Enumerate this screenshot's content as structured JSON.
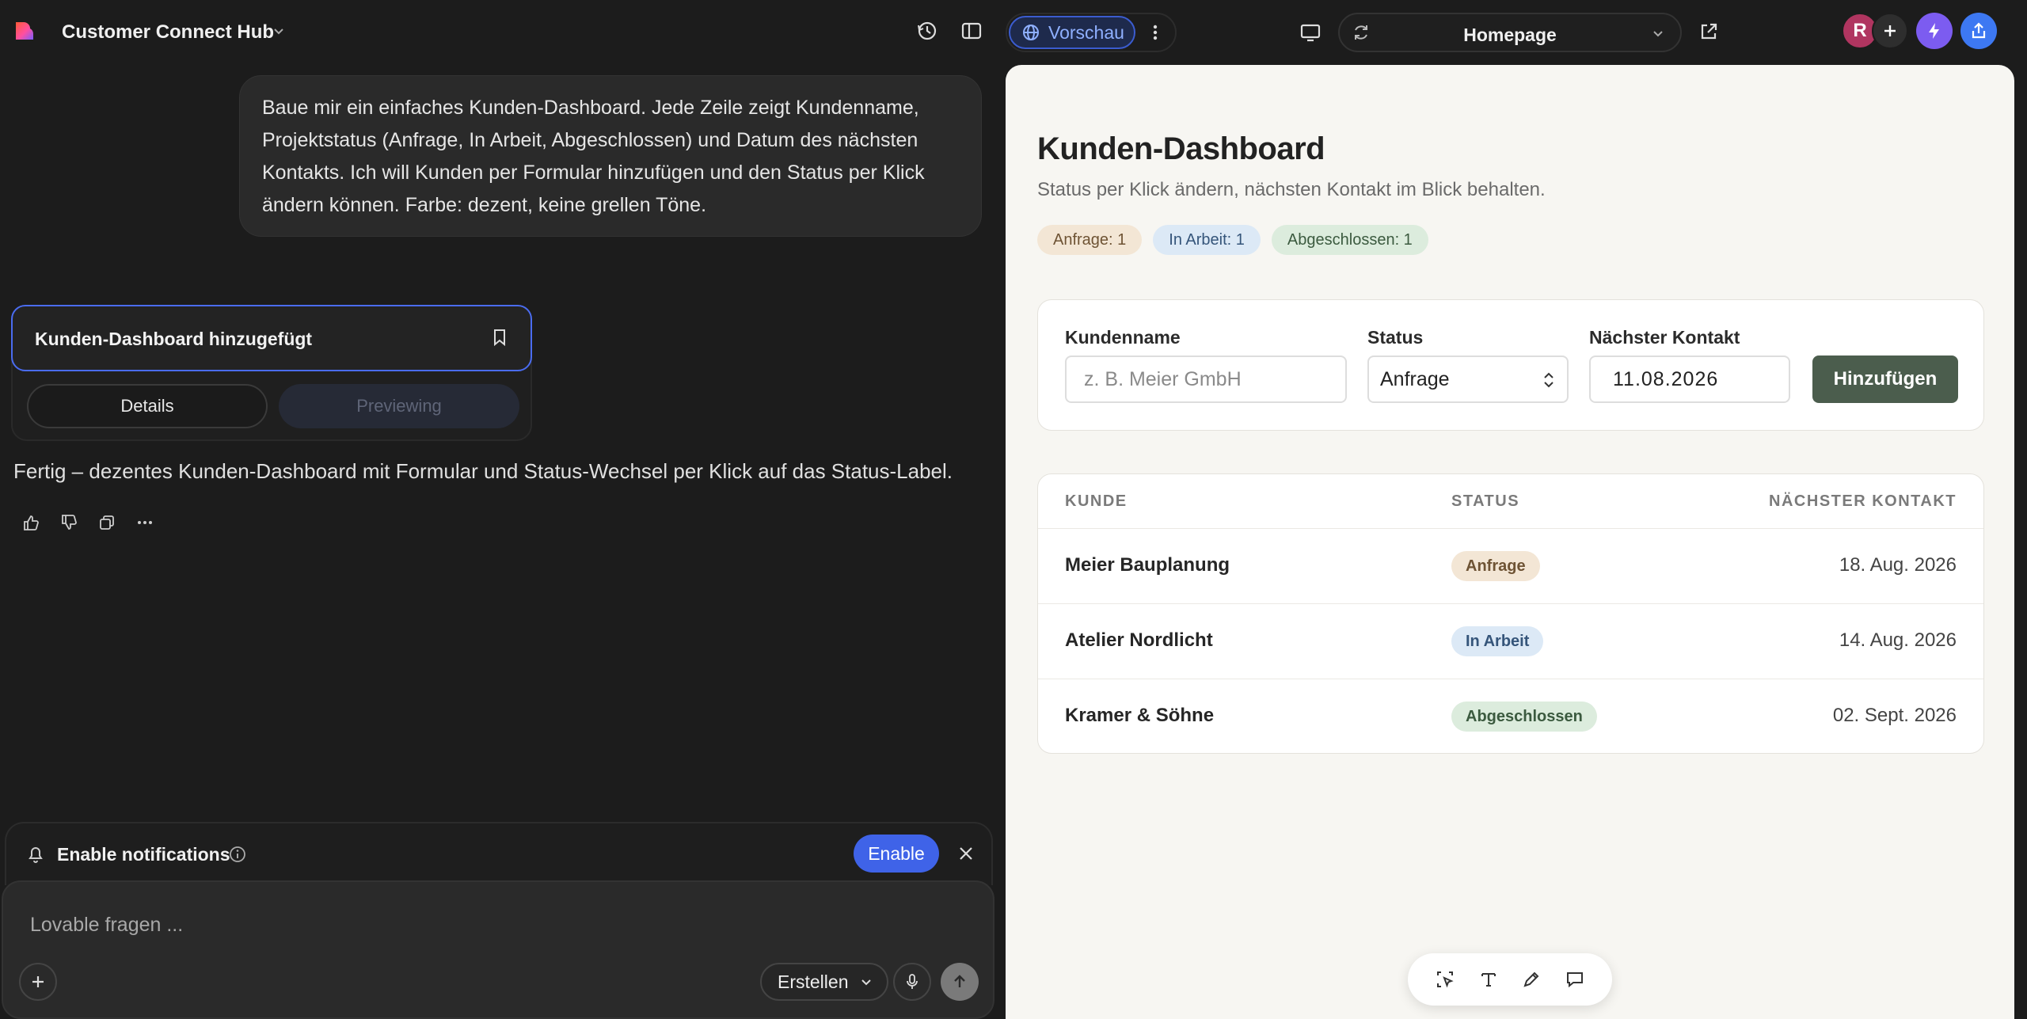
{
  "topbar": {
    "project_name": "Customer Connect Hub",
    "preview_label": "Vorschau",
    "page_name": "Homepage",
    "avatar_initial": "R"
  },
  "chat": {
    "user_message": "Baue mir ein einfaches Kunden-Dashboard. Jede Zeile zeigt Kundenname, Projektstatus (Anfrage, In Arbeit, Abgeschlossen) und Datum des nächsten Kontakts. Ich will Kunden per Formular hinzufügen und den Status per Klick ändern können. Farbe: dezent, keine grellen Töne.",
    "action_card": {
      "title": "Kunden-Dashboard hinzugefügt",
      "details_label": "Details",
      "previewing_label": "Previewing"
    },
    "answer": "Fertig – dezentes Kunden-Dashboard mit Formular und Status-Wechsel per Klick auf das Status-Label."
  },
  "notification": {
    "text": "Enable notifications",
    "enable_label": "Enable"
  },
  "composer": {
    "placeholder": "Lovable fragen ...",
    "mode": "Erstellen"
  },
  "dashboard": {
    "title": "Kunden-Dashboard",
    "subtitle": "Status per Klick ändern, nächsten Kontakt im Blick behalten.",
    "counts": {
      "anfrage": "Anfrage: 1",
      "in_arbeit": "In Arbeit: 1",
      "abgeschlossen": "Abgeschlossen: 1"
    },
    "form": {
      "name_label": "Kundenname",
      "name_placeholder": "z. B. Meier GmbH",
      "status_label": "Status",
      "status_value": "Anfrage",
      "date_label": "Nächster Kontakt",
      "date_value": "11.08.2026",
      "submit_label": "Hinzufügen"
    },
    "table": {
      "headers": [
        "KUNDE",
        "STATUS",
        "NÄCHSTER KONTAKT"
      ],
      "rows": [
        {
          "name": "Meier Bauplanung",
          "status": "Anfrage",
          "date": "18. Aug. 2026"
        },
        {
          "name": "Atelier Nordlicht",
          "status": "In Arbeit",
          "date": "14. Aug. 2026"
        },
        {
          "name": "Kramer & Söhne",
          "status": "Abgeschlossen",
          "date": "02. Sept. 2026"
        }
      ]
    }
  },
  "colors": {
    "accent_blue": "#3f63e8",
    "badge_request_bg": "#f3e6d5",
    "badge_work_bg": "#dce9f6",
    "badge_done_bg": "#dcecdd",
    "submit_bg": "#4b5d4d"
  },
  "icons": [
    "lovable-logo-icon",
    "chevron-down-icon",
    "history-icon",
    "sidebar-icon",
    "globe-icon",
    "more-vertical-icon",
    "monitor-icon",
    "refresh-icon",
    "external-link-icon",
    "plus-icon",
    "bolt-icon",
    "share-icon",
    "bookmark-icon",
    "thumbs-up-icon",
    "thumbs-down-icon",
    "copy-icon",
    "more-horizontal-icon",
    "bell-icon",
    "info-icon",
    "close-icon",
    "mic-icon",
    "arrow-up-icon",
    "select-tool-icon",
    "text-tool-icon",
    "pencil-icon",
    "comment-icon"
  ]
}
